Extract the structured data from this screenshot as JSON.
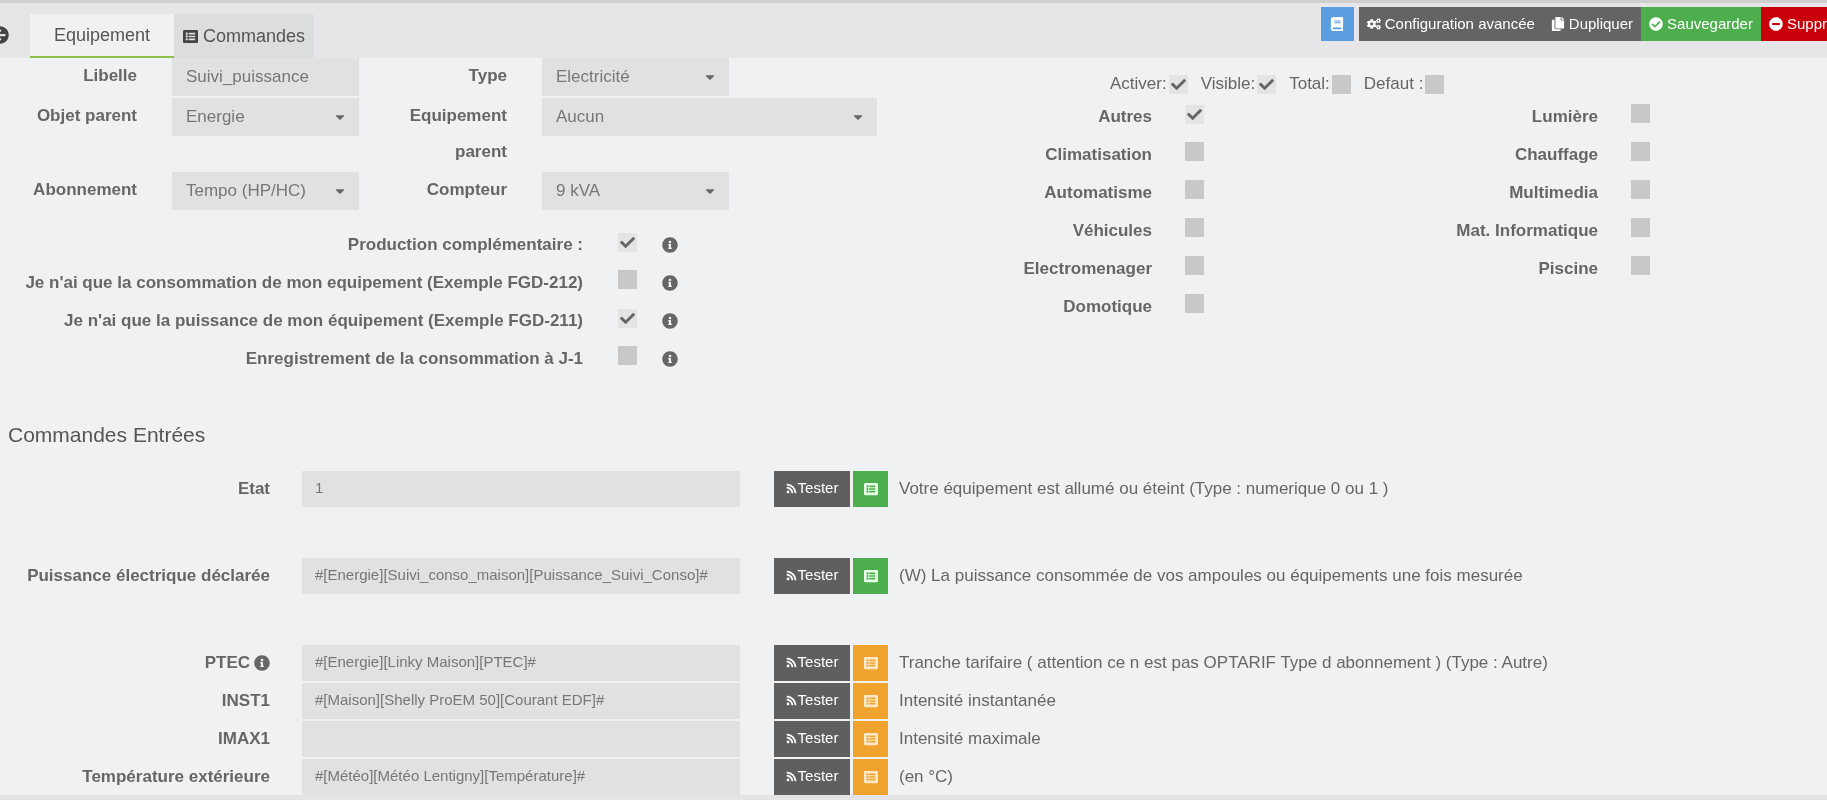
{
  "tabs": [
    {
      "label": "Equipement",
      "selected": true
    },
    {
      "label": "Commandes",
      "selected": false
    }
  ],
  "toolbar": [
    {
      "kind": "notice"
    },
    {
      "kind": "config",
      "label": "Configuration avancée"
    },
    {
      "kind": "duplicate",
      "label": "Dupliquer"
    },
    {
      "kind": "save",
      "label": "Sauvegarder"
    },
    {
      "kind": "remove",
      "label": "Suppr"
    }
  ],
  "form": {
    "rows": [
      [
        {
          "label": "Libelle",
          "kind": "input",
          "value": "Suivi_puissance"
        },
        {
          "label": "Type",
          "kind": "select",
          "value": "Electricité"
        }
      ],
      [
        {
          "label": "Objet parent",
          "kind": "select",
          "value": "Energie"
        },
        {
          "label": "Equipement parent",
          "kind": "select",
          "value": "Aucun"
        }
      ],
      [
        {
          "label": "Abonnement",
          "kind": "select",
          "value": "Tempo (HP/HC)"
        },
        {
          "label": "Compteur",
          "kind": "select",
          "value": "9 kVA"
        }
      ]
    ],
    "options": [
      {
        "label": "Production complémentaire :",
        "checked": true
      },
      {
        "label": "Je n'ai que la consommation de mon equipement (Exemple FGD-212)",
        "checked": false
      },
      {
        "label": "Je n'ai que la puissance de mon équipement (Exemple FGD-211)",
        "checked": true
      },
      {
        "label": "Enregistrement de la consommation à J-1",
        "checked": false
      }
    ]
  },
  "flags": [
    {
      "label": "Activer:",
      "checked": true
    },
    {
      "label": "Visible:",
      "checked": true
    },
    {
      "label": "Total:",
      "checked": false
    },
    {
      "label": "Defaut :",
      "checked": false
    }
  ],
  "categories": [
    {
      "label": "Autres",
      "checked": true
    },
    {
      "label": "Lumière",
      "checked": false
    },
    {
      "label": "Climatisation",
      "checked": false
    },
    {
      "label": "Chauffage",
      "checked": false
    },
    {
      "label": "Automatisme",
      "checked": false
    },
    {
      "label": "Multimedia",
      "checked": false
    },
    {
      "label": "Véhicules",
      "checked": false
    },
    {
      "label": "Mat. Informatique",
      "checked": false
    },
    {
      "label": "Electromenager",
      "checked": false
    },
    {
      "label": "Piscine",
      "checked": false
    },
    {
      "label": "Domotique",
      "checked": false
    }
  ],
  "commands": {
    "title": "Commandes Entrées",
    "groups": [
      [
        {
          "label": "Etat",
          "info": false,
          "value": "1",
          "test": "Tester",
          "kind": "action",
          "description": "Votre équipement est allumé ou éteint (Type : numerique 0 ou 1 )"
        }
      ],
      [
        {
          "label": "Puissance électrique déclarée",
          "info": false,
          "value": "#[Energie][Suivi_conso_maison][Puissance_Suivi_Conso]#",
          "test": "Tester",
          "kind": "action",
          "description": "(W) La puissance consommée de vos ampoules ou équipements une fois mesurée"
        }
      ],
      [
        {
          "label": "PTEC",
          "info": true,
          "value": "#[Energie][Linky Maison][PTEC]#",
          "test": "Tester",
          "kind": "info",
          "description": "Tranche tarifaire ( attention ce n est pas OPTARIF Type d abonnement ) (Type : Autre)"
        },
        {
          "label": "INST1",
          "info": false,
          "value": "#[Maison][Shelly ProEM 50][Courant EDF]#",
          "test": "Tester",
          "kind": "info",
          "description": "Intensité instantanée"
        },
        {
          "label": "IMAX1",
          "info": false,
          "test": "Tester",
          "kind": "info",
          "description": "Intensité maximale"
        },
        {
          "label": "Température extérieure",
          "info": false,
          "value": "#[Météo][Météo Lentigny][Température]#",
          "test": "Tester",
          "kind": "info",
          "description": "(en °C)"
        }
      ]
    ]
  }
}
